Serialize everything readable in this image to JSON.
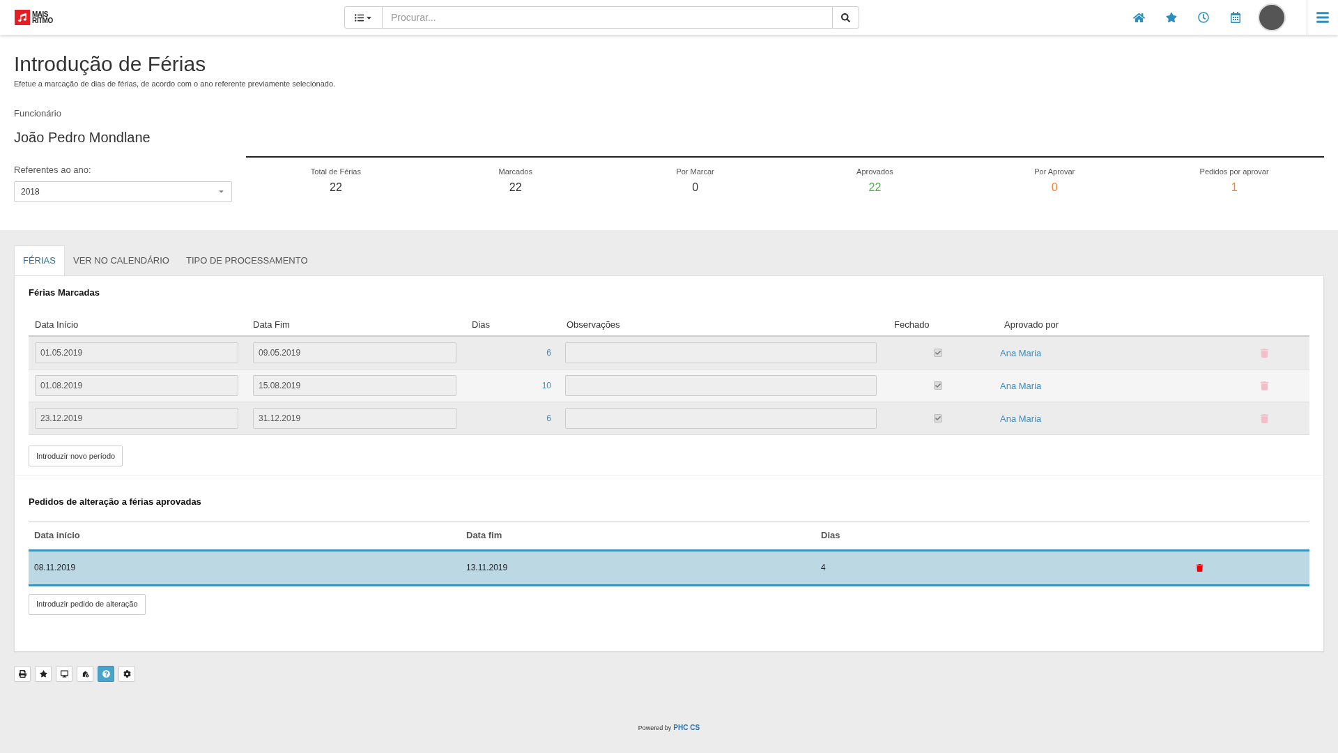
{
  "header": {
    "brand": [
      "MAIS",
      "RITMO"
    ],
    "search": {
      "placeholder": "Procurar..."
    }
  },
  "page": {
    "title": "Introdução de Férias",
    "subtitle": "Efetue a marcação de dias de férias, de acordo com o ano referente previamente selecionado.",
    "employee_label": "Funcionário",
    "employee_name": "João Pedro Mondlane",
    "year_label": "Referentes ao ano:",
    "year_value": "2018"
  },
  "stats": [
    {
      "label": "Total de Férias",
      "value": "22",
      "color": "#333333"
    },
    {
      "label": "Marcados",
      "value": "22",
      "color": "#333333"
    },
    {
      "label": "Por Marcar",
      "value": "0",
      "color": "#333333"
    },
    {
      "label": "Aprovados",
      "value": "22",
      "color": "#4caf50"
    },
    {
      "label": "Por Aprovar",
      "value": "0",
      "color": "#ff7f27"
    },
    {
      "label": "Pedidos por aprovar",
      "value": "1",
      "color": "#ff7f27"
    }
  ],
  "tabs": [
    {
      "label": "FÉRIAS",
      "selected": true
    },
    {
      "label": "VER NO CALENDÁRIO",
      "selected": false
    },
    {
      "label": "TIPO DE PROCESSAMENTO",
      "selected": false
    }
  ],
  "vacations": {
    "title": "Férias Marcadas",
    "columns": [
      "Data Início",
      "Data Fim",
      "Dias",
      "Observações",
      "Fechado",
      "Aprovado por"
    ],
    "rows": [
      {
        "start": "01.05.2019",
        "end": "09.05.2019",
        "days": "6",
        "closed": true,
        "approved_by": "Ana Maria",
        "deletable": false
      },
      {
        "start": "01.08.2019",
        "end": "15.08.2019",
        "days": "10",
        "closed": true,
        "approved_by": "Ana Maria",
        "deletable": false
      },
      {
        "start": "23.12.2019",
        "end": "31.12.2019",
        "days": "6",
        "closed": true,
        "approved_by": "Ana Maria",
        "deletable": false
      }
    ],
    "button": "Introduzir novo período"
  },
  "requests": {
    "title": "Pedidos de alteração a férias aprovadas",
    "columns": [
      "Data início",
      "Data fim",
      "Dias"
    ],
    "rows": [
      {
        "start": "08.11.2019",
        "end": "13.11.2019",
        "days": "4",
        "selected": true,
        "deletable": true
      }
    ],
    "button": "Introduzir pedido de alteração"
  },
  "toolbar": [
    {
      "selected": false
    },
    {
      "selected": false
    },
    {
      "selected": false
    },
    {
      "selected": false
    },
    {
      "selected": true
    },
    {
      "selected": false
    }
  ],
  "footer": {
    "text": "Powered by",
    "link": "PHC CS"
  }
}
